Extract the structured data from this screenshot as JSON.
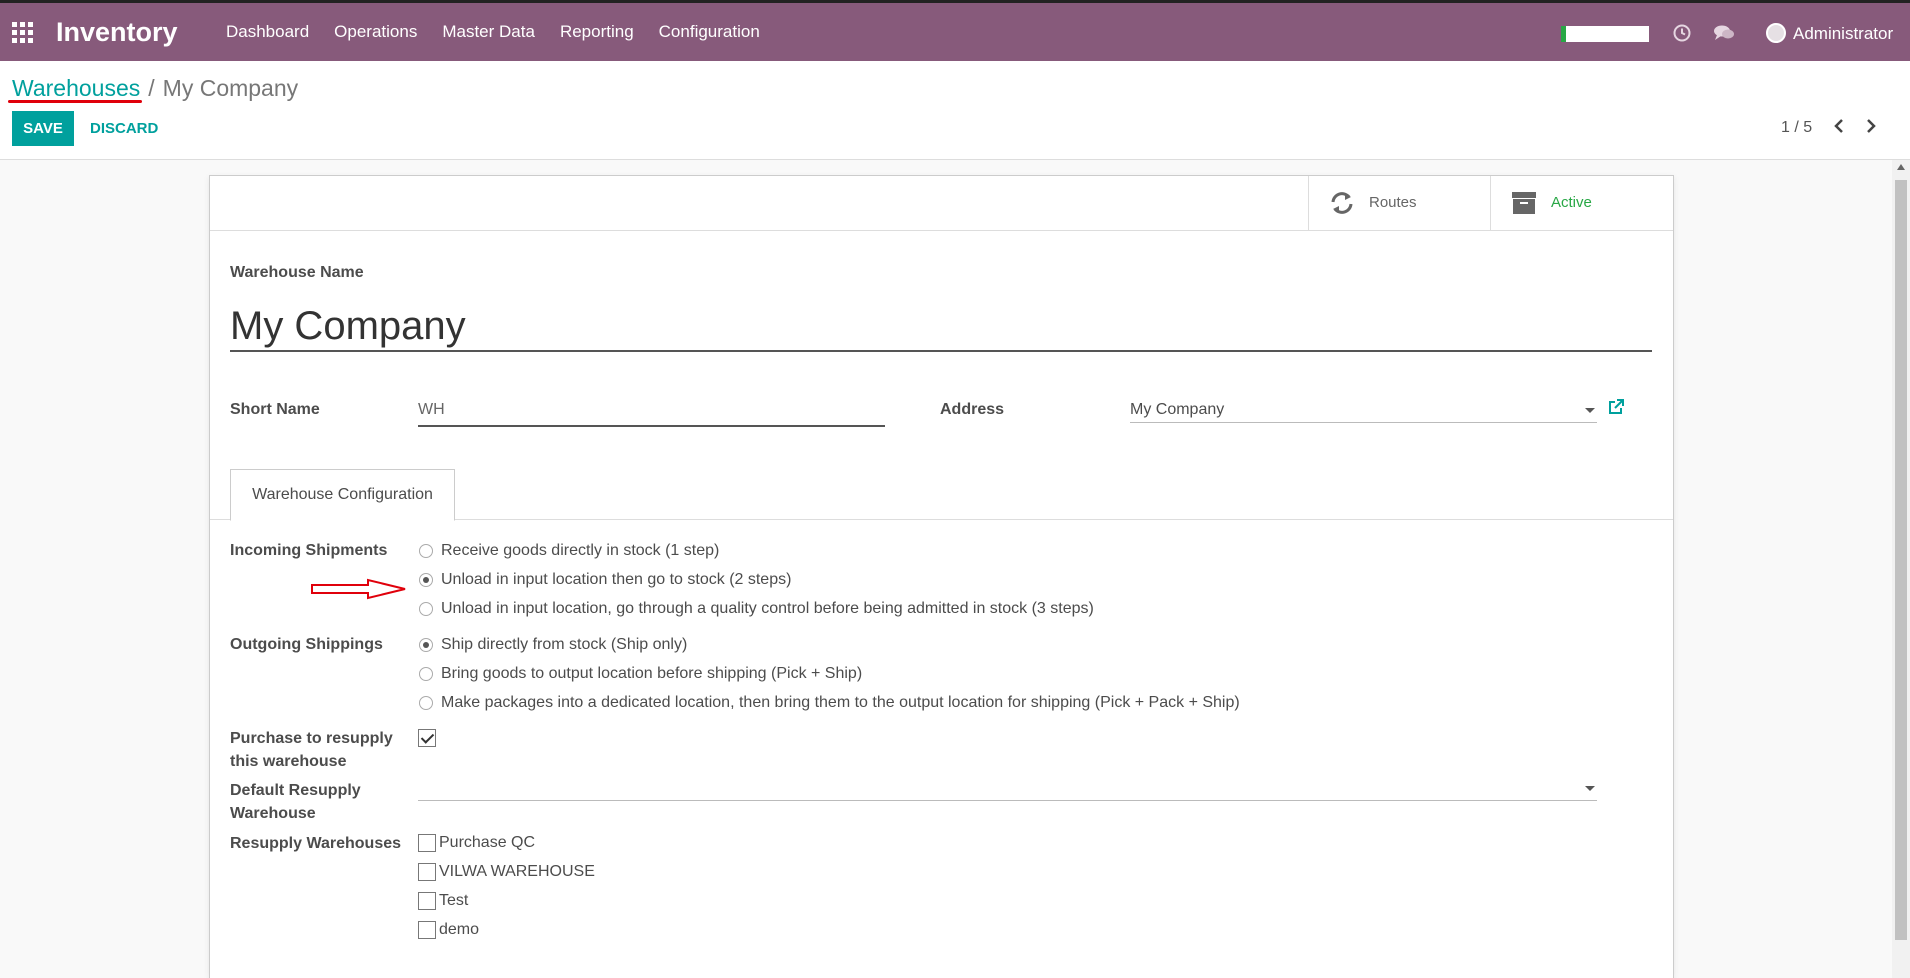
{
  "navbar": {
    "brand": "Inventory",
    "menu": [
      "Dashboard",
      "Operations",
      "Master Data",
      "Reporting",
      "Configuration"
    ],
    "user": "Administrator",
    "accent": "#875a7b"
  },
  "breadcrumb": {
    "parent": "Warehouses",
    "separator": "/",
    "current": "My Company"
  },
  "actions": {
    "save_label": "SAVE",
    "discard_label": "DISCARD"
  },
  "pager": {
    "value": "1 / 5"
  },
  "smart_buttons": {
    "routes": "Routes",
    "active": "Active"
  },
  "form": {
    "name_label": "Warehouse Name",
    "name_value": "My Company",
    "short_name_label": "Short Name",
    "short_name_value": "WH",
    "address_label": "Address",
    "address_value": "My Company",
    "tab_label": "Warehouse Configuration",
    "incoming_label": "Incoming Shipments",
    "incoming_options": [
      {
        "label": "Receive goods directly in stock (1 step)",
        "checked": false
      },
      {
        "label": "Unload in input location then go to stock (2 steps)",
        "checked": true
      },
      {
        "label": "Unload in input location, go through a quality control before being admitted in stock (3 steps)",
        "checked": false
      }
    ],
    "outgoing_label": "Outgoing Shippings",
    "outgoing_options": [
      {
        "label": "Ship directly from stock (Ship only)",
        "checked": true
      },
      {
        "label": "Bring goods to output location before shipping (Pick + Ship)",
        "checked": false
      },
      {
        "label": "Make packages into a dedicated location, then bring them to the output location for shipping (Pick + Pack + Ship)",
        "checked": false
      }
    ],
    "purchase_label_line1": "Purchase to resupply",
    "purchase_label_line2": "this warehouse",
    "purchase_checked": true,
    "default_resupply_label_line1": "Default Resupply",
    "default_resupply_label_line2": "Warehouse",
    "resupply_label": "Resupply Warehouses",
    "resupply_warehouses": [
      "Purchase QC",
      "VILWA WAREHOUSE",
      "Test",
      "demo"
    ]
  },
  "icons": {
    "apps": "apps-grid-icon",
    "clock": "clock-icon",
    "chat": "chat-icon",
    "routes": "refresh-icon",
    "active": "archive-icon",
    "external": "external-link-icon",
    "arrow": "red-arrow-annotation"
  }
}
